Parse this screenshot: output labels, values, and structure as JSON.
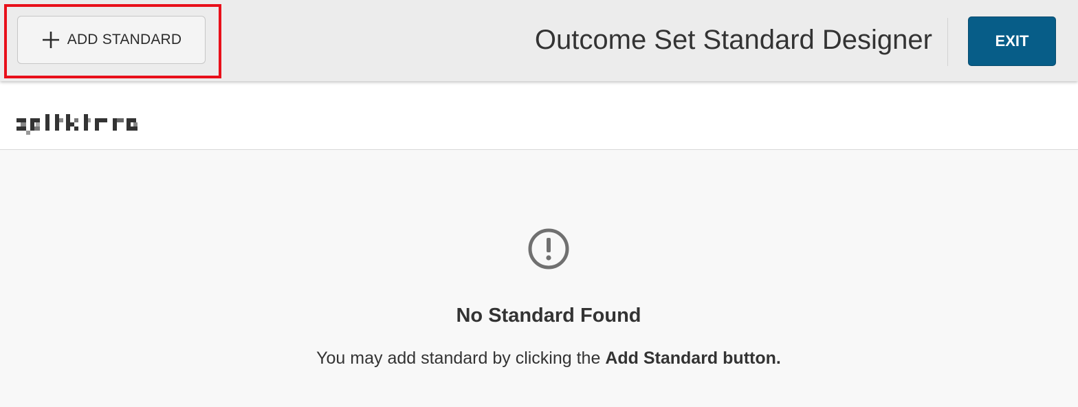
{
  "toolbar": {
    "add_label": "ADD STANDARD",
    "add_icon": "plus-icon",
    "title": "Outcome Set Standard Designer",
    "exit_label": "EXIT",
    "exit_color": "#075d88",
    "highlight_color": "#e8101a"
  },
  "subheader": {
    "name_redacted": true
  },
  "empty_state": {
    "icon": "alert-circle-icon",
    "title": "No Standard Found",
    "message_prefix": "You may add standard by clicking the ",
    "message_bold": "Add Standard button."
  }
}
